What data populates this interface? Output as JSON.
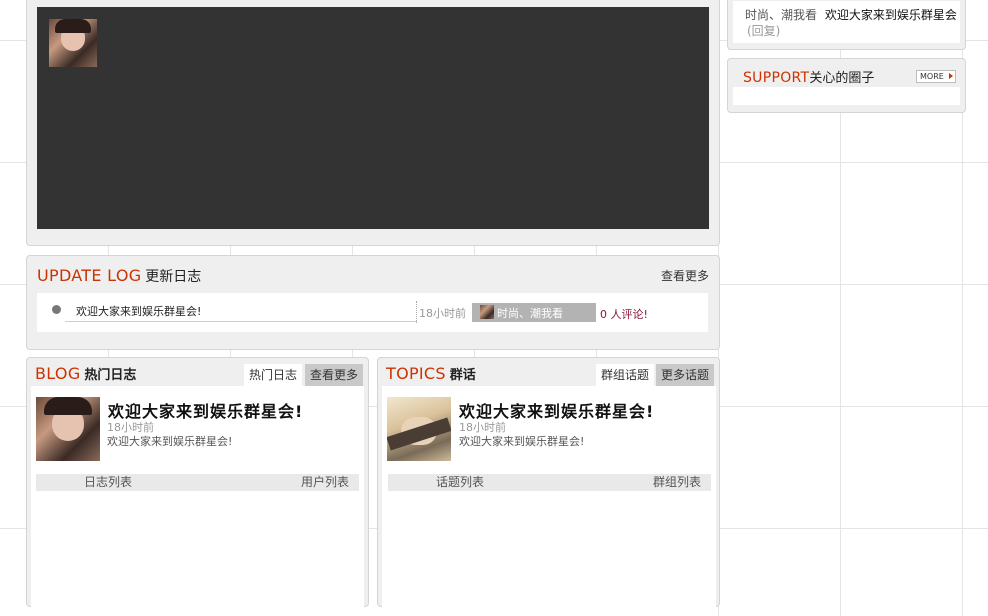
{
  "gallery": {
    "avatar_icon": "user-avatar-photo"
  },
  "side_top": {
    "text": "时尚、潮我看",
    "link": "欢迎大家来到娱乐群星会",
    "reply": "(回复)"
  },
  "support": {
    "title_en": "SUPPORT",
    "title_cn": "关心的圈子",
    "more_label": "MORE",
    "more_icon": "triangle-right-icon"
  },
  "update_log": {
    "title_en": "UPDATE LOG",
    "title_cn": "更新日志",
    "more_link": "查看更多",
    "entries": [
      {
        "text": "欢迎大家来到娱乐群星会!",
        "time": "18小时前",
        "user": "时尚、潮我看",
        "comments": "0 人评论!"
      }
    ]
  },
  "blog": {
    "title_en": "BLOG",
    "title_cn": "热门日志",
    "tabs": [
      "热门日志",
      "查看更多"
    ],
    "post": {
      "title": "欢迎大家来到娱乐群星会!",
      "time": "18小时前",
      "desc": "欢迎大家来到娱乐群星会!"
    },
    "list_left": "日志列表",
    "list_right": "用户列表"
  },
  "topics": {
    "title_en": "TOPICS",
    "title_cn": "群话",
    "tabs": [
      "群组话题",
      "更多话题"
    ],
    "post": {
      "title": "欢迎大家来到娱乐群星会!",
      "time": "18小时前",
      "desc": "欢迎大家来到娱乐群星会!"
    },
    "list_left": "话题列表",
    "list_right": "群组列表"
  },
  "colors": {
    "accent": "#cc3300",
    "dark_panel": "#333333",
    "comment": "#8a1538"
  }
}
